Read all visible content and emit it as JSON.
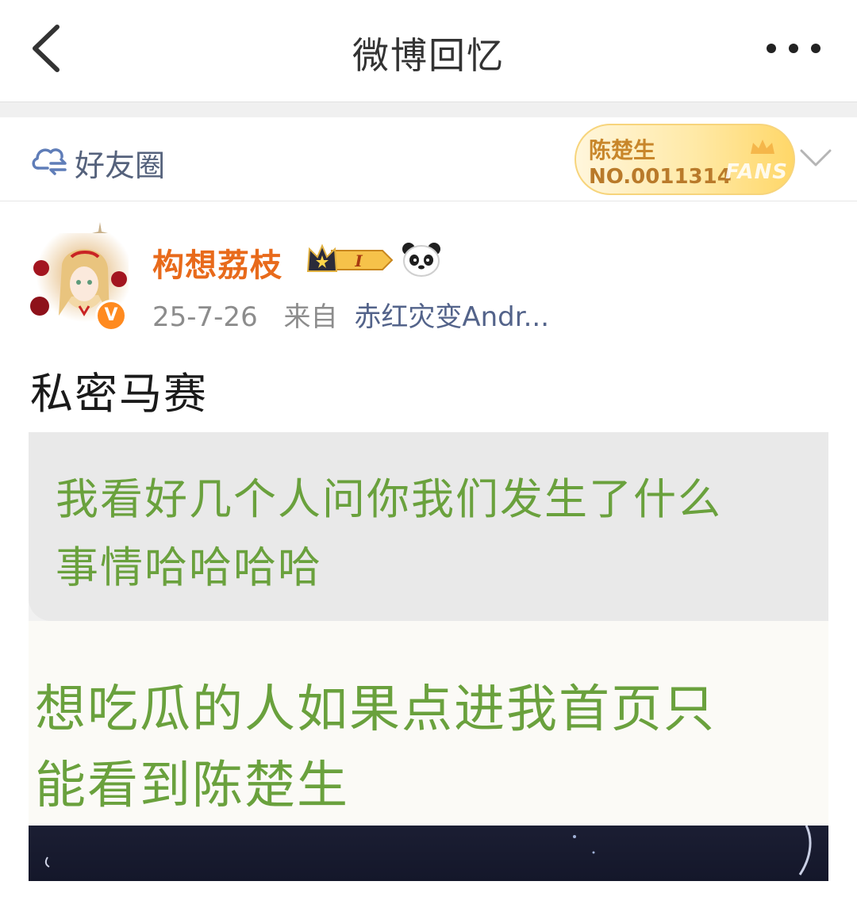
{
  "nav": {
    "back_icon": "chevron-left-icon",
    "title": "微博回忆",
    "more_icon": "more-dots-icon"
  },
  "visibility": {
    "icon": "friends-circle-icon",
    "label": "好友圈"
  },
  "fans_badge": {
    "name": "陈楚生",
    "number": "NO.0011314",
    "word": "FANS"
  },
  "post": {
    "username": "构想荔枝",
    "avatar_badge": "V",
    "date": "25-7-26",
    "from_label": "来自",
    "source": "赤红灾变Andr...",
    "text": "私密马赛",
    "image_text": {
      "line1": "我看好几个人问你我们发生了什么",
      "line2": "事情哈哈哈哈",
      "line3": "想吃瓜的人如果点进我首页只",
      "line4": "能看到陈楚生"
    }
  },
  "colors": {
    "username": "#e86a1b",
    "source_link": "#53638a",
    "image_green_text": "#6aa13d",
    "fans_gold": "#c8862a"
  }
}
